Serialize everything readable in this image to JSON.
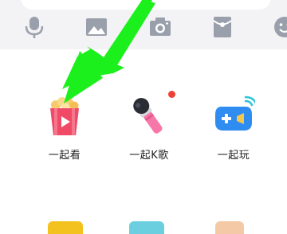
{
  "toolbar": {
    "icons": [
      "microphone-icon",
      "image-icon",
      "camera-icon",
      "red-packet-icon",
      "emoji-icon"
    ],
    "icon_color": "#9aa0ab"
  },
  "apps": [
    {
      "label": "一起看",
      "icon": "popcorn-icon",
      "badge": false
    },
    {
      "label": "一起K歌",
      "icon": "karaoke-microphone-icon",
      "badge": true
    },
    {
      "label": "一起玩",
      "icon": "gamepad-icon",
      "badge": false
    }
  ],
  "colors": {
    "badge": "#ef4136",
    "annotation_arrow": "#1cf01c",
    "toolbar_bg": "#f3f3f6"
  }
}
